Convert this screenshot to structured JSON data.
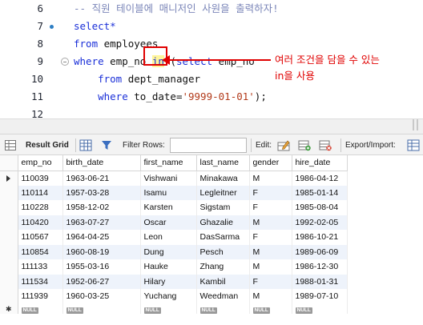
{
  "editor": {
    "lines": [
      {
        "num": "6",
        "dot": false,
        "fold": false,
        "tokens": [
          {
            "t": "-- 직원 테이블에 매니저인 사원을 출력하자!",
            "c": "cm"
          }
        ]
      },
      {
        "num": "7",
        "dot": true,
        "fold": false,
        "tokens": [
          {
            "t": "select*",
            "c": "kw"
          }
        ]
      },
      {
        "num": "8",
        "dot": false,
        "fold": false,
        "tokens": [
          {
            "t": "from",
            "c": "kw"
          },
          {
            "t": " employees",
            "c": "tx"
          }
        ]
      },
      {
        "num": "9",
        "dot": false,
        "fold": true,
        "tokens": [
          {
            "t": "where",
            "c": "kw"
          },
          {
            "t": " emp_no ",
            "c": "tx"
          },
          {
            "t": "in",
            "c": "kw",
            "hl": true
          },
          {
            "t": " (",
            "c": "tx"
          },
          {
            "t": "select",
            "c": "kw"
          },
          {
            "t": " emp_no",
            "c": "tx"
          }
        ]
      },
      {
        "num": "10",
        "dot": false,
        "fold": false,
        "tokens": [
          {
            "t": "    ",
            "c": "tx"
          },
          {
            "t": "from",
            "c": "kw"
          },
          {
            "t": " dept_manager",
            "c": "tx"
          }
        ]
      },
      {
        "num": "11",
        "dot": false,
        "fold": false,
        "tokens": [
          {
            "t": "    ",
            "c": "tx"
          },
          {
            "t": "where",
            "c": "kw"
          },
          {
            "t": " to_date=",
            "c": "tx"
          },
          {
            "t": "'9999-01-01'",
            "c": "str"
          },
          {
            "t": ");",
            "c": "tx"
          }
        ]
      },
      {
        "num": "12",
        "dot": false,
        "fold": false,
        "tokens": []
      }
    ],
    "annotation_line1": "여러 조건을 담을 수 있는",
    "annotation_line2": "in을 사용",
    "annotation_color": "#e00000"
  },
  "toolbar": {
    "result_grid_label": "Result Grid",
    "filter_rows_label": "Filter Rows:",
    "filter_rows_value": "",
    "edit_label": "Edit:",
    "export_label": "Export/Import:"
  },
  "grid": {
    "columns": [
      "emp_no",
      "birth_date",
      "first_name",
      "last_name",
      "gender",
      "hire_date"
    ],
    "rows": [
      [
        "110039",
        "1963-06-21",
        "Vishwani",
        "Minakawa",
        "M",
        "1986-04-12"
      ],
      [
        "110114",
        "1957-03-28",
        "Isamu",
        "Legleitner",
        "F",
        "1985-01-14"
      ],
      [
        "110228",
        "1958-12-02",
        "Karsten",
        "Sigstam",
        "F",
        "1985-08-04"
      ],
      [
        "110420",
        "1963-07-27",
        "Oscar",
        "Ghazalie",
        "M",
        "1992-02-05"
      ],
      [
        "110567",
        "1964-04-25",
        "Leon",
        "DasSarma",
        "F",
        "1986-10-21"
      ],
      [
        "110854",
        "1960-08-19",
        "Dung",
        "Pesch",
        "M",
        "1989-06-09"
      ],
      [
        "111133",
        "1955-03-16",
        "Hauke",
        "Zhang",
        "M",
        "1986-12-30"
      ],
      [
        "111534",
        "1952-06-27",
        "Hilary",
        "Kambil",
        "F",
        "1988-01-31"
      ],
      [
        "111939",
        "1960-03-25",
        "Yuchang",
        "Weedman",
        "M",
        "1989-07-10"
      ]
    ],
    "null_label": "NULL"
  }
}
